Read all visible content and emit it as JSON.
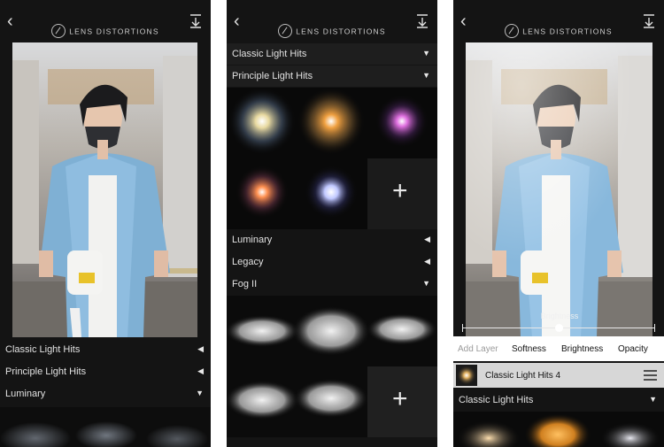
{
  "app": {
    "title": "LENS DISTORTIONS"
  },
  "icons": {
    "back": "back-chevron-icon",
    "download": "download-icon",
    "logo": "lens-distortions-logo-icon",
    "menu": "hamburger-menu-icon",
    "add": "plus-icon"
  },
  "screen1": {
    "categories": [
      {
        "label": "Classic Light Hits",
        "state": "collapsed"
      },
      {
        "label": "Principle Light Hits",
        "state": "collapsed"
      },
      {
        "label": "Luminary",
        "state": "expanded"
      }
    ]
  },
  "screen2": {
    "categories": [
      {
        "label": "Classic Light Hits"
      },
      {
        "label": "Principle Light Hits"
      },
      {
        "label": "Luminary"
      },
      {
        "label": "Legacy"
      },
      {
        "label": "Fog II"
      }
    ]
  },
  "screen3": {
    "slider": {
      "label": "Brightness",
      "value": 0.5
    },
    "tabs": [
      "Add Layer",
      "Softness",
      "Brightness",
      "Opacity"
    ],
    "layer": {
      "name": "Classic Light Hits 4"
    },
    "category": {
      "label": "Classic Light Hits"
    }
  }
}
